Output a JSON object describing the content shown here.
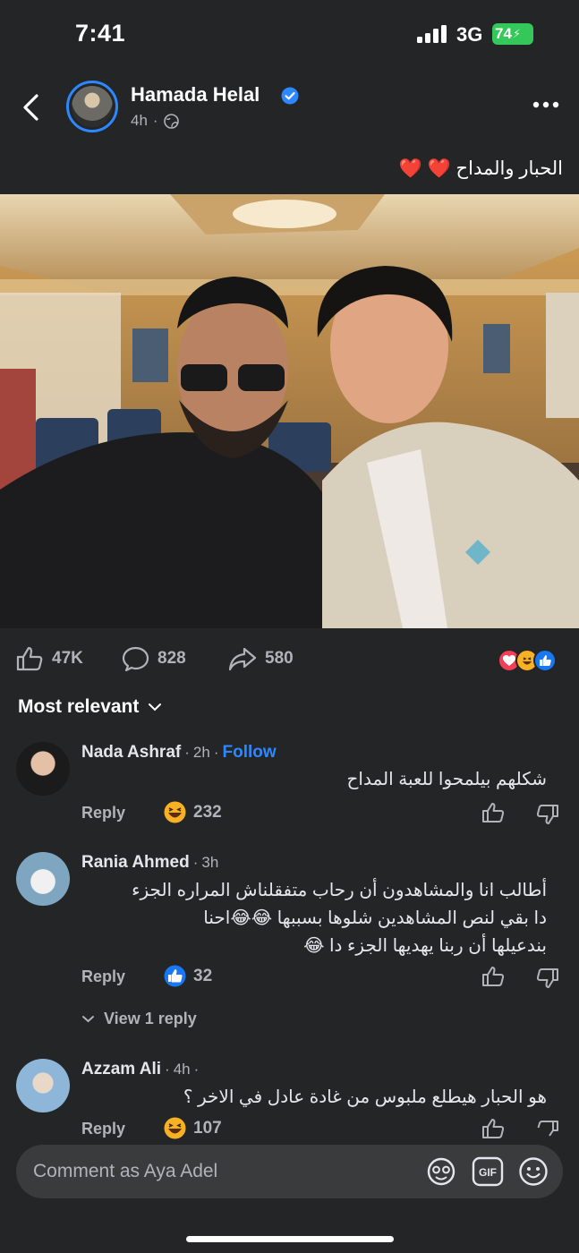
{
  "status_bar": {
    "time": "7:41",
    "network": "3G",
    "battery": "74"
  },
  "post": {
    "author": "Hamada Helal",
    "time": "4h",
    "caption": "الحبار والمداح ❤️ ❤️",
    "stats": {
      "likes": "47K",
      "comments": "828",
      "shares": "580"
    }
  },
  "sort_label": "Most relevant",
  "comments": [
    {
      "name": "Nada Ashraf",
      "time": "2h",
      "follow": "Follow",
      "text": "شكلهم بيلمحوا للعبة المداح",
      "reply": "Reply",
      "reaction_count": "232"
    },
    {
      "name": "Rania Ahmed",
      "time": "3h",
      "lines": [
        "أطالب انا والمشاهدون أن رحاب متفقلناش المراره الجزء",
        "دا بقي لنص المشاهدين شلوها بسببها 😂😂احنا",
        "بندعيلها أن ربنا يهديها الجزء دا 😂"
      ],
      "reply": "Reply",
      "reaction_count": "32",
      "view_replies": "View 1 reply"
    },
    {
      "name": "Azzam Ali",
      "time": "4h",
      "text": "هو الحبار هيطلع ملبوس من غادة عادل في الاخر ؟",
      "reply": "Reply",
      "reaction_count": "107"
    }
  ],
  "composer": {
    "placeholder": "Comment as Aya Adel"
  },
  "colors": {
    "background": "#242526",
    "accent": "#2d88ff",
    "secondary_text": "#b0b3b8"
  }
}
